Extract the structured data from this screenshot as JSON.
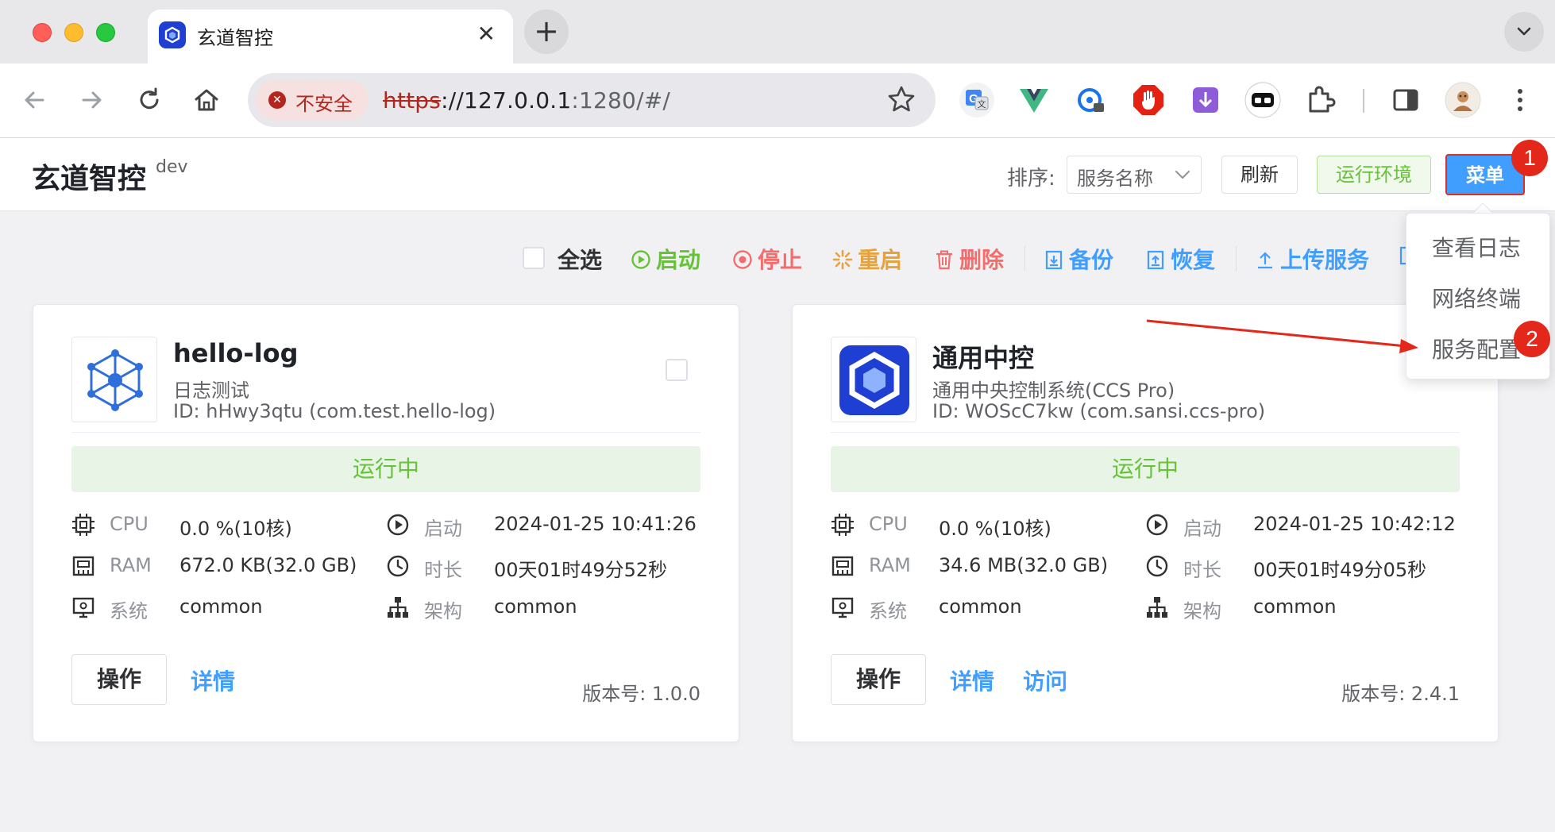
{
  "browser": {
    "tab_title": "玄道智控",
    "security_chip": "不安全",
    "url_scheme": "https",
    "url_rest": "://127.0.0.1",
    "url_port_path": ":1280/#/"
  },
  "header": {
    "app_title": "玄道智控",
    "env_tag": "dev",
    "sort_label": "排序:",
    "sort_value": "服务名称",
    "refresh_label": "刷新",
    "runtime_env_label": "运行环境",
    "menu_label": "菜单"
  },
  "annotations": {
    "badge_1": "1",
    "badge_2": "2"
  },
  "actions": {
    "select_all": "全选",
    "start": "启动",
    "stop": "停止",
    "restart": "重启",
    "delete": "删除",
    "backup": "备份",
    "restore": "恢复",
    "upload": "上传服务"
  },
  "menu_dropdown": {
    "items": [
      "查看日志",
      "网络终端",
      "服务配置"
    ]
  },
  "services": [
    {
      "name": "hello-log",
      "description": "日志测试",
      "id": "ID: hHwy3qtu (com.test.hello-log)",
      "status": "运行中",
      "cpu_label": "CPU",
      "cpu_value": "0.0 %(10核)",
      "ram_label": "RAM",
      "ram_value": "672.0 KB(32.0 GB)",
      "os_label": "系统",
      "os_value": "common",
      "start_label": "启动",
      "start_value": "2024-01-25 10:41:26",
      "uptime_label": "时长",
      "uptime_value": "00天01时49分52秒",
      "arch_label": "架构",
      "arch_value": "common",
      "op_label": "操作",
      "detail_label": "详情",
      "version": "版本号: 1.0.0"
    },
    {
      "name": "通用中控",
      "description": "通用中央控制系统(CCS Pro)",
      "id": "ID: WOScC7kw (com.sansi.ccs-pro)",
      "status": "运行中",
      "cpu_label": "CPU",
      "cpu_value": "0.0 %(10核)",
      "ram_label": "RAM",
      "ram_value": "34.6 MB(32.0 GB)",
      "os_label": "系统",
      "os_value": "common",
      "start_label": "启动",
      "start_value": "2024-01-25 10:42:12",
      "uptime_label": "时长",
      "uptime_value": "00天01时49分05秒",
      "arch_label": "架构",
      "arch_value": "common",
      "op_label": "操作",
      "detail_label": "详情",
      "visit_label": "访问",
      "version": "版本号: 2.4.1"
    }
  ],
  "colors": {
    "primary": "#409eff",
    "success": "#67c23a",
    "danger": "#f56c6c",
    "warning": "#e6a23c",
    "annotation_red": "#e3271b"
  }
}
